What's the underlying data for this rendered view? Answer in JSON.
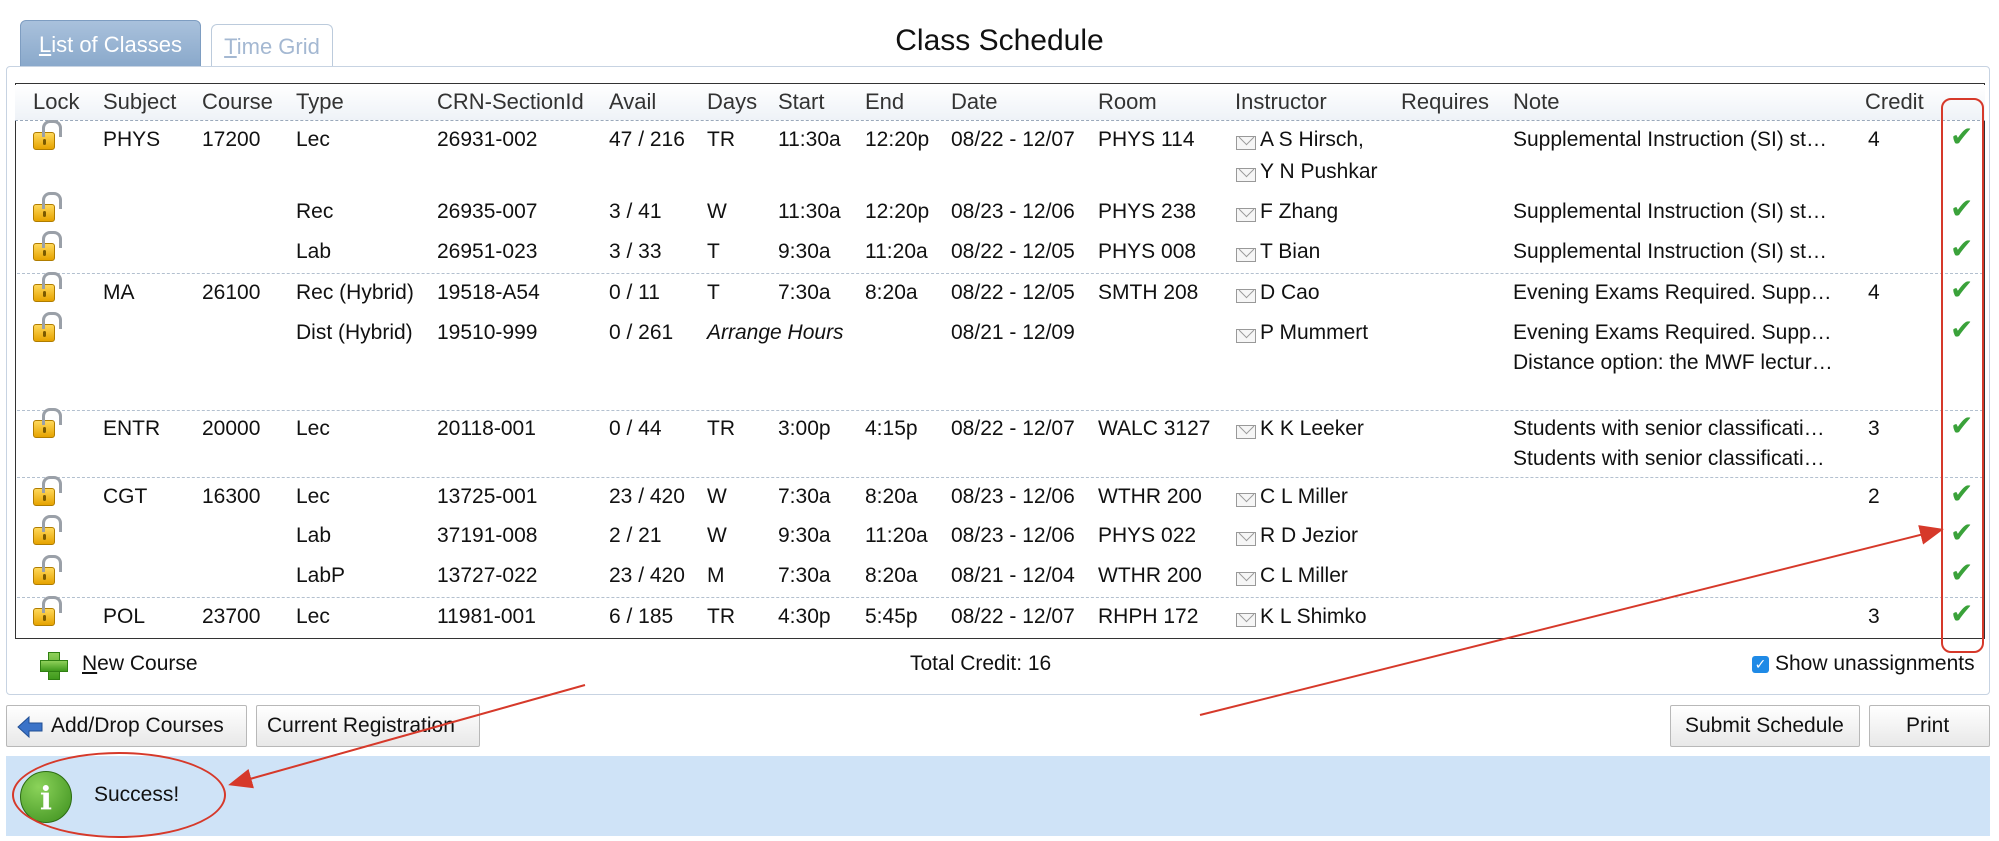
{
  "tabs": [
    {
      "first": "L",
      "rest": "ist of Classes"
    },
    {
      "first": "T",
      "rest": "ime Grid"
    }
  ],
  "title": "Class Schedule",
  "columns": [
    "Lock",
    "Subject",
    "Course",
    "Type",
    "CRN-SectionId",
    "Avail",
    "Days",
    "Start",
    "End",
    "Date",
    "Room",
    "Instructor",
    "Requires",
    "Note",
    "Credit"
  ],
  "rows": [
    {
      "subject": "PHYS",
      "course": "17200",
      "type": "Lec",
      "crn": "26931-002",
      "avail": "47 / 216",
      "days": "TR",
      "start": "11:30a",
      "end": "12:20p",
      "date": "08/22 - 12/07",
      "room": "PHYS 114",
      "instructor": "A S Hirsch,",
      "instructor2": "Y N Pushkar",
      "note": "Supplemental Instruction (SI) st…",
      "credit": "4"
    },
    {
      "subject": "",
      "course": "",
      "type": "Rec",
      "crn": "26935-007",
      "avail": "3 / 41",
      "days": "W",
      "start": "11:30a",
      "end": "12:20p",
      "date": "08/23 - 12/06",
      "room": "PHYS 238",
      "instructor": "F Zhang",
      "note": "Supplemental Instruction (SI) st…",
      "credit": ""
    },
    {
      "subject": "",
      "course": "",
      "type": "Lab",
      "crn": "26951-023",
      "avail": "3 / 33",
      "days": "T",
      "start": "9:30a",
      "end": "11:20a",
      "date": "08/22 - 12/05",
      "room": "PHYS 008",
      "instructor": "T Bian",
      "note": "Supplemental Instruction (SI) st…",
      "credit": ""
    },
    {
      "subject": "MA",
      "course": "26100",
      "type": "Rec (Hybrid)",
      "crn": "19518-A54",
      "avail": "0 / 11",
      "days": "T",
      "start": "7:30a",
      "end": "8:20a",
      "date": "08/22 - 12/05",
      "room": "SMTH 208",
      "instructor": "D Cao",
      "note": "Evening Exams Required. Supp…",
      "credit": "4"
    },
    {
      "subject": "",
      "course": "",
      "type": "Dist (Hybrid)",
      "crn": "19510-999",
      "avail": "0 / 261",
      "days": "Arrange Hours",
      "start": "",
      "end": "",
      "date": "08/21 - 12/09",
      "room": "",
      "instructor": "P Mummert",
      "note": "Evening Exams Required. Supp…",
      "note2": "Distance option: the MWF lectur…",
      "credit": ""
    },
    {
      "subject": "ENTR",
      "course": "20000",
      "type": "Lec",
      "crn": "20118-001",
      "avail": "0 / 44",
      "days": "TR",
      "start": "3:00p",
      "end": "4:15p",
      "date": "08/22 - 12/07",
      "room": "WALC 3127",
      "instructor": "K K Leeker",
      "note": "Students with senior classificati…",
      "note2": "Students with senior classificati…",
      "credit": "3"
    },
    {
      "subject": "CGT",
      "course": "16300",
      "type": "Lec",
      "crn": "13725-001",
      "avail": "23 / 420",
      "days": "W",
      "start": "7:30a",
      "end": "8:20a",
      "date": "08/23 - 12/06",
      "room": "WTHR 200",
      "instructor": "C L Miller",
      "note": "",
      "credit": "2"
    },
    {
      "subject": "",
      "course": "",
      "type": "Lab",
      "crn": "37191-008",
      "avail": "2 / 21",
      "days": "W",
      "start": "9:30a",
      "end": "11:20a",
      "date": "08/23 - 12/06",
      "room": "PHYS 022",
      "instructor": "R D Jezior",
      "note": "",
      "credit": ""
    },
    {
      "subject": "",
      "course": "",
      "type": "LabP",
      "crn": "13727-022",
      "avail": "23 / 420",
      "days": "M",
      "start": "7:30a",
      "end": "8:20a",
      "date": "08/21 - 12/04",
      "room": "WTHR 200",
      "instructor": "C L Miller",
      "note": "",
      "credit": ""
    },
    {
      "subject": "POL",
      "course": "23700",
      "type": "Lec",
      "crn": "11981-001",
      "avail": "6 / 185",
      "days": "TR",
      "start": "4:30p",
      "end": "5:45p",
      "date": "08/22 - 12/07",
      "room": "RHPH 172",
      "instructor": "K L Shimko",
      "note": "",
      "credit": "3"
    }
  ],
  "footer": {
    "new_course_first": "N",
    "new_course_rest": "ew Course",
    "total_credit": "Total Credit: 16",
    "show_unassignments": "Show unassignments",
    "show_unassignments_checked": true
  },
  "buttons": {
    "add_drop": "Add/Drop Courses",
    "current_registration": "Current Registration",
    "submit_schedule": "Submit Schedule",
    "print": "Print"
  },
  "message": {
    "icon": "info-icon",
    "text": "Success!"
  },
  "colors": {
    "accent": "#8aa9cb",
    "message_bg": "#cfe3f7",
    "annotation": "#d6392a",
    "check": "#3aa23a"
  }
}
